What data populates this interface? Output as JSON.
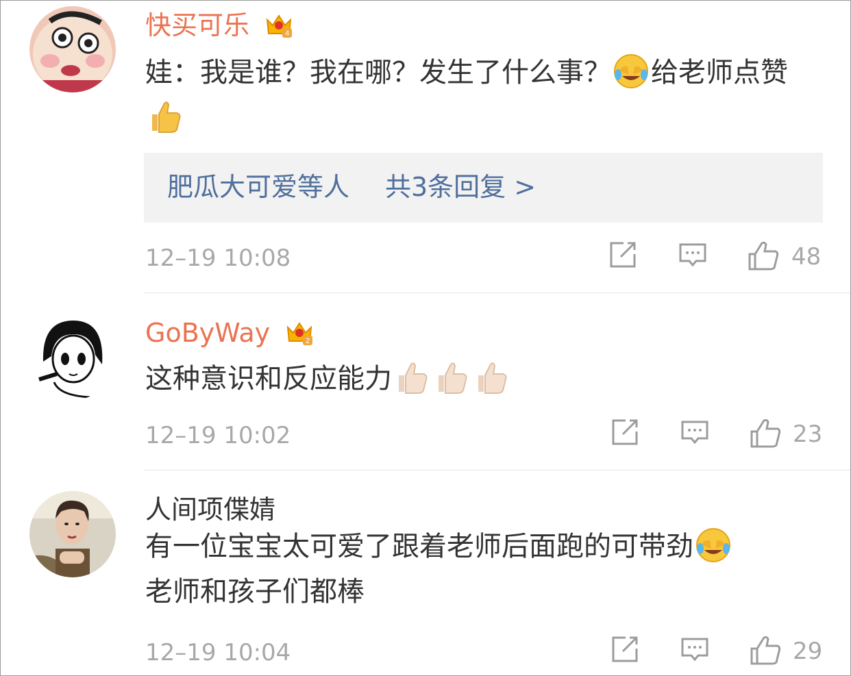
{
  "colors": {
    "vip_name": "#eb7350",
    "link_blue": "#4f6f9c",
    "meta_gray": "#a8a8a8",
    "reply_bg": "#f2f2f2"
  },
  "comments": [
    {
      "username": "快买可乐",
      "vip_badge": "crown-vip-4",
      "text_parts": [
        "娃：我是谁？我在哪？发生了什么事？",
        "给老师点赞"
      ],
      "emojis": [
        "laugh-cry-emoji",
        "thumbs-up-emoji"
      ],
      "replies": {
        "users": "肥瓜大可爱等人",
        "count_label": "共3条回复 >"
      },
      "timestamp": "12–19 10:08",
      "likes": "48"
    },
    {
      "username": "GoByWay",
      "vip_badge": "crown-vip-2",
      "text_parts": [
        "这种意识和反应能力"
      ],
      "emojis": [
        "thumbs-up-emoji",
        "thumbs-up-emoji",
        "thumbs-up-emoji"
      ],
      "timestamp": "12–19 10:02",
      "likes": "23"
    },
    {
      "username": "人间项偞婧",
      "text_parts": [
        "有一位宝宝太可爱了跟着老师后面跑的可带劲",
        "老师和孩子们都棒"
      ],
      "emojis": [
        "laugh-cry-emoji"
      ],
      "timestamp": "12–19 10:04",
      "likes": "29"
    }
  ]
}
